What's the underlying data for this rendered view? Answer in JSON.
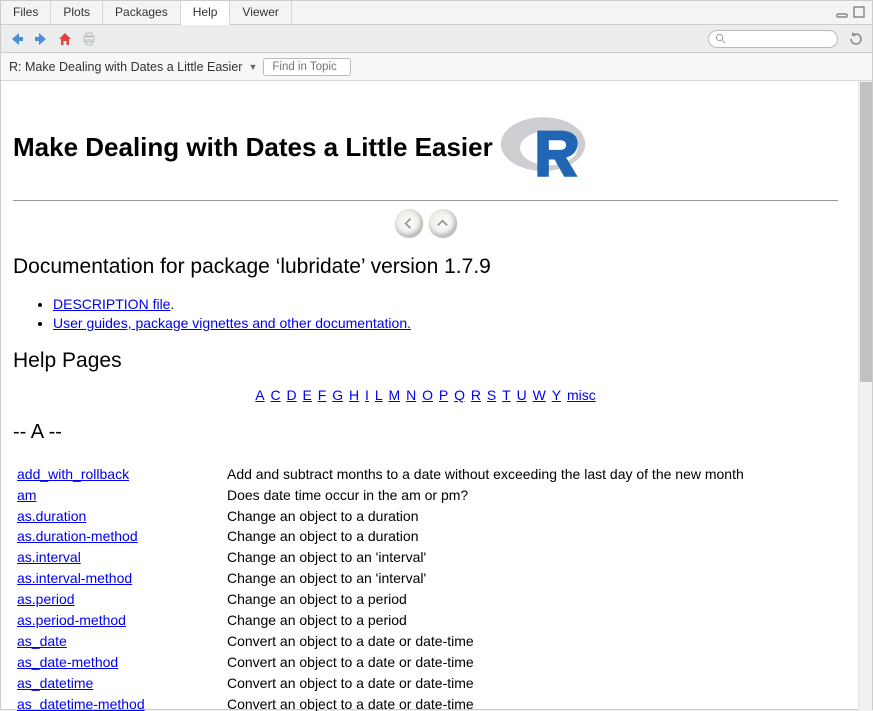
{
  "tabs": {
    "files": "Files",
    "plots": "Plots",
    "packages": "Packages",
    "help": "Help",
    "viewer": "Viewer"
  },
  "subbar": {
    "title": "R: Make Dealing with Dates a Little Easier",
    "find_placeholder": "Find in Topic"
  },
  "search": {
    "placeholder": ""
  },
  "doc": {
    "h1": "Make Dealing with Dates a Little Easier",
    "h2": "Documentation for package ‘lubridate’ version 1.7.9",
    "links": {
      "desc": "DESCRIPTION file",
      "vignettes": "User guides, package vignettes and other documentation."
    },
    "h3": "Help Pages",
    "index": [
      "A",
      "C",
      "D",
      "E",
      "F",
      "G",
      "H",
      "I",
      "L",
      "M",
      "N",
      "O",
      "P",
      "Q",
      "R",
      "S",
      "T",
      "U",
      "W",
      "Y",
      "misc"
    ],
    "h4": "-- A --",
    "rows": [
      {
        "fn": "add_with_rollback",
        "desc": "Add and subtract months to a date without exceeding the last day of the new month"
      },
      {
        "fn": "am",
        "desc": "Does date time occur in the am or pm?"
      },
      {
        "fn": "as.duration",
        "desc": "Change an object to a duration"
      },
      {
        "fn": "as.duration-method",
        "desc": "Change an object to a duration"
      },
      {
        "fn": "as.interval",
        "desc": "Change an object to an 'interval'"
      },
      {
        "fn": "as.interval-method",
        "desc": "Change an object to an 'interval'"
      },
      {
        "fn": "as.period",
        "desc": "Change an object to a period"
      },
      {
        "fn": "as.period-method",
        "desc": "Change an object to a period"
      },
      {
        "fn": "as_date",
        "desc": "Convert an object to a date or date-time"
      },
      {
        "fn": "as_date-method",
        "desc": "Convert an object to a date or date-time"
      },
      {
        "fn": "as_datetime",
        "desc": "Convert an object to a date or date-time"
      },
      {
        "fn": "as_datetime-method",
        "desc": "Convert an object to a date or date-time"
      }
    ]
  }
}
